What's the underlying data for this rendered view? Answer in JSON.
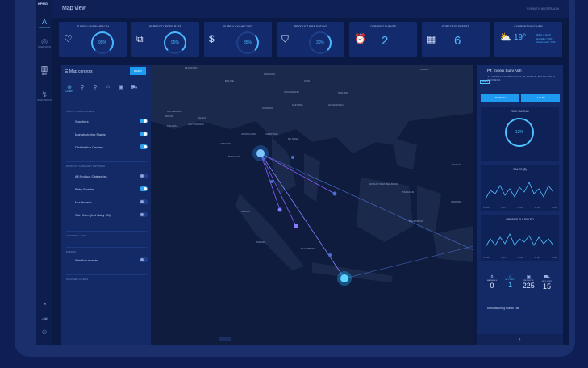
{
  "app": {
    "logo": "KPMG",
    "title": "Map view",
    "location": "SYDNEY, AUSTRALIA"
  },
  "nav": [
    {
      "label": "GROWTH",
      "icon": "Λ"
    },
    {
      "label": "OVERVIEW",
      "icon": "◎"
    },
    {
      "label": "MAP",
      "icon": "▥"
    },
    {
      "label": "SCENARIOS",
      "icon": "↯"
    }
  ],
  "kpis": {
    "supply_chain_health": {
      "label": "Supply Chain Health",
      "value": "95%"
    },
    "perfect_order_rate": {
      "label": "Perfect Order Rate",
      "value": "95%"
    },
    "supply_chain_cost": {
      "label": "Supply Chain Cost",
      "value": "35%"
    },
    "product_risk_rating": {
      "label": "Product Risk Rating",
      "value": "30%"
    },
    "current_events": {
      "label": "Current Events",
      "value": "2"
    },
    "forecast_events": {
      "label": "Forecast Events",
      "value": "6"
    },
    "current_weather": {
      "label": "Current Weather",
      "temp": "19°",
      "wind": "Wind: 6 km/h",
      "humidity": "Humidity: 54%",
      "cloud": "Cloud cover: 70%"
    }
  },
  "map_controls": {
    "title": "Map controls",
    "reset": "RESET",
    "layers_tab": "LAYERS",
    "supply_chain_layers": "SUPPLY CHAIN LAYERS",
    "suppliers": "Suppliers",
    "manufacturing_plants": "Manufacturing Plants",
    "distribution_centres": "Distribution Centres",
    "product_category_network": "PRODUCT CATEGORY NETWORK",
    "all_product_categories": "All Product Categories",
    "baby_powder": "Baby Powder",
    "mouthwash": "Mouthwash",
    "skin_care": "Skin Care (Incl Baby Oil)",
    "country_layer": "COUNTRY LAYER",
    "events": "EVENTS",
    "weather_events": "Weather events",
    "weather_layers": "WEATHER LAYERS"
  },
  "map_labels": {
    "l1": "MULANSKIY",
    "l2": "BOLIVE",
    "l3": "LANZHOU",
    "l4": "XIAN",
    "l5": "CHONGQING",
    "l6": "NANJING",
    "l7": "OSAKA",
    "l8": "KATHMANDU",
    "l9": "PATNA",
    "l10": "KOLKATA",
    "l11": "CHITTAGONG",
    "l12": "GUIYANG",
    "l13": "KUNMING",
    "l14": "HONG KONG",
    "l15": "YANGON",
    "l16": "CHIANG MAI",
    "l17": "VIENTIANE",
    "l18": "DA NANG",
    "l19": "DAVAO",
    "l20": "BANDAR SERI BEGAWAN",
    "l21": "TARAKAN",
    "l22": "MEDAN",
    "l23": "BALIKPAPAN",
    "l24": "PADANG",
    "l25": "PALEMBANG",
    "l26": "SORONG",
    "l27": "DHAKA",
    "l28": "BANGKOK"
  },
  "detail": {
    "name": "PT. Evonik Sumi Asih",
    "address": "JL. CEMPAKA JATIMEKAR KM. 58, TAMBUN, BEKASI TIMUR, INDONESIA",
    "badge": "TIER 2",
    "zoom_in": "ZOOM IN",
    "hub": "HUB TO",
    "risk_title": "RISK RATING",
    "risk_value": "12%",
    "sales_title": "SALES ($)",
    "orders_title": "ORDERS FULFILLED",
    "dates": [
      "25 Mar",
      "4 Apr",
      "13 Apr",
      "22 Apr",
      "1 May"
    ],
    "stats": [
      {
        "label": "MATERIALS",
        "value": "0"
      },
      {
        "label": "MF. PLANTS",
        "value": "1"
      },
      {
        "label": "PRODUCTS",
        "value": "225"
      },
      {
        "label": "DIST. CENT.",
        "value": "15"
      }
    ],
    "mfg_list": "Manufacturing Plants List"
  },
  "colors": {
    "accent": "#4fc3ff",
    "panel": "#132a66",
    "bg": "#0b1a45"
  }
}
